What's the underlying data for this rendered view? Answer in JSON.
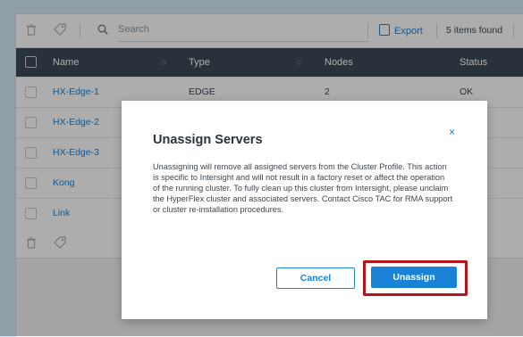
{
  "toolbar": {
    "search_placeholder": "Search",
    "export_label": "Export",
    "items_found": "5 items found"
  },
  "table": {
    "columns": [
      "Name",
      "Type",
      "Nodes",
      "Status"
    ],
    "rows": [
      {
        "name": "HX-Edge-1",
        "type": "EDGE",
        "nodes": "2",
        "status": "OK"
      },
      {
        "name": "HX-Edge-2",
        "type": "",
        "nodes": "",
        "status": ""
      },
      {
        "name": "HX-Edge-3",
        "type": "",
        "nodes": "",
        "status": ""
      },
      {
        "name": "Kong",
        "type": "",
        "nodes": "",
        "status": ""
      },
      {
        "name": "Link",
        "type": "",
        "nodes": "",
        "status": ""
      }
    ]
  },
  "modal": {
    "title": "Unassign Servers",
    "body": "Unassigning will remove all assigned servers from the Cluster Profile. This action is specific to Intersight and will not result in a factory reset or affect the operation of the running cluster. To fully clean up this cluster from Intersight, please unclaim the HyperFlex cluster and associated servers. Contact Cisco TAC for RMA support or cluster re-installation procedures.",
    "cancel_label": "Cancel",
    "confirm_label": "Unassign",
    "close_symbol": "×"
  },
  "colors": {
    "accent": "#1a83d7",
    "header_bg": "#3d4a58",
    "highlight": "#b3141a"
  }
}
